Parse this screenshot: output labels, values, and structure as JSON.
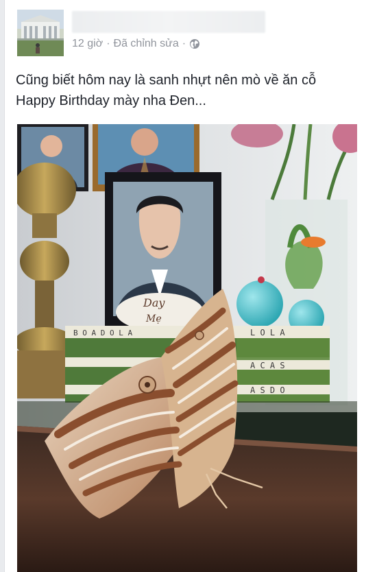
{
  "post": {
    "timestamp": "12 giờ",
    "edited_label": "Đã chỉnh sửa",
    "separator": "·",
    "audience_icon": "globe-icon",
    "text_line1": "Cũng biết hôm nay là sanh nhựt nên mò về ăn cỗ",
    "text_line2": "Happy Birthday mày nha Đen..."
  },
  "photo": {
    "cake_text_1": "Day",
    "cake_text_2": "Mẹ",
    "box_letters_top": "L O L A",
    "box_letters_mid": "A C A S",
    "box_letters_low": "A S D O",
    "box_letters_left": "B O A D O L A"
  },
  "colors": {
    "meta_gray": "#90949c",
    "text_dark": "#1d2129",
    "page_bg": "#e9ebee",
    "card_bg": "#ffffff"
  }
}
